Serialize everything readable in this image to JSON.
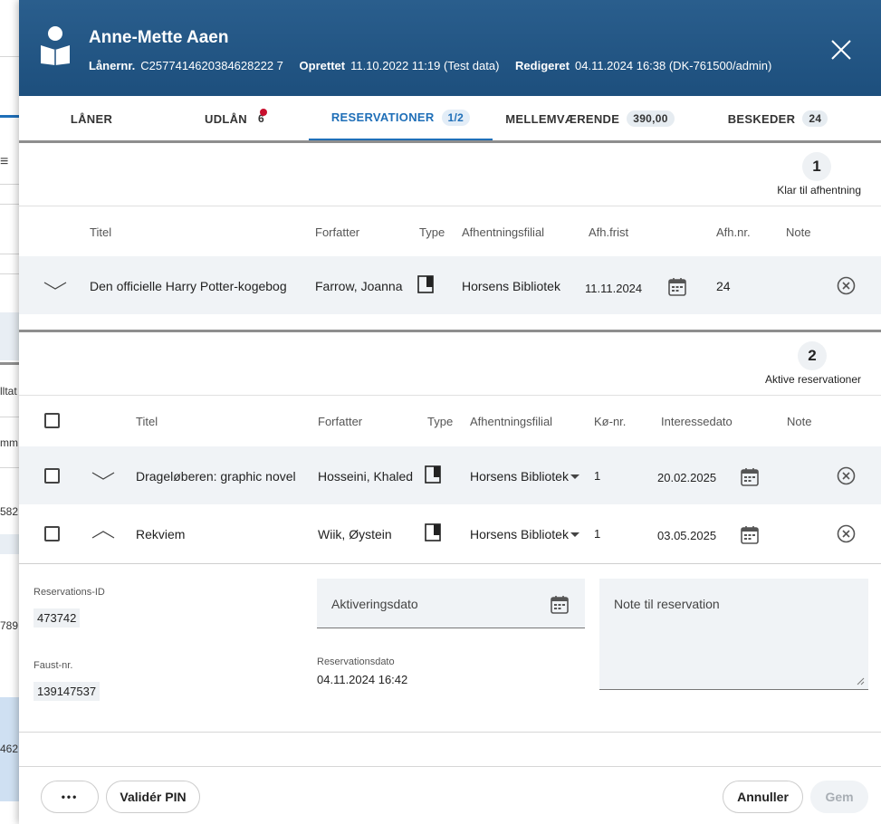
{
  "background": {
    "fragments": [
      "lltat",
      "mm",
      "582",
      "789",
      "462"
    ]
  },
  "header": {
    "name": "Anne-Mette Aaen",
    "laanernr_label": "Lånernr.",
    "laanernr_value": "C2577414620384628222 7",
    "oprettet_label": "Oprettet",
    "oprettet_value": "11.10.2022 11:19 (Test data)",
    "redigeret_label": "Redigeret",
    "redigeret_value": "04.11.2024 16:38 (DK-761500/admin)"
  },
  "tabs": [
    {
      "label": "LÅNER",
      "badge": ""
    },
    {
      "label": "UDLÅN",
      "badge": "6"
    },
    {
      "label": "RESERVATIONER",
      "badge": "1/2"
    },
    {
      "label": "MELLEMVÆRENDE",
      "badge": "390,00"
    },
    {
      "label": "BESKEDER",
      "badge": "24"
    }
  ],
  "section1": {
    "number": "1",
    "label": "Klar til afhentning",
    "columns": {
      "titel": "Titel",
      "forfatter": "Forfatter",
      "type": "Type",
      "afhentningsfilial": "Afhentningsfilial",
      "afhfrist": "Afh.frist",
      "afhnr": "Afh.nr.",
      "note": "Note"
    },
    "rows": [
      {
        "titel": "Den officielle Harry Potter-kogebog",
        "forfatter": "Farrow, Joanna",
        "filial": "Horsens Bibliotek",
        "frist": "11.11.2024",
        "afhnr": "24"
      }
    ]
  },
  "section2": {
    "number": "2",
    "label": "Aktive reservationer",
    "columns": {
      "titel": "Titel",
      "forfatter": "Forfatter",
      "type": "Type",
      "afhentningsfilial": "Afhentningsfilial",
      "koenr": "Kø-nr.",
      "interessedato": "Interessedato",
      "note": "Note"
    },
    "rows": [
      {
        "titel": "Drageløberen: graphic novel",
        "forfatter": "Hosseini, Khaled",
        "filial": "Horsens Bibliotek",
        "koenr": "1",
        "dato": "20.02.2025"
      },
      {
        "titel": "Rekviem",
        "forfatter": "Wiik, Øystein",
        "filial": "Horsens Bibliotek",
        "koenr": "1",
        "dato": "03.05.2025"
      }
    ]
  },
  "detail": {
    "reservations_id_label": "Reservations-ID",
    "reservations_id_value": "473742",
    "faust_label": "Faust-nr.",
    "faust_value": "139147537",
    "aktiveringsdato_placeholder": "Aktiveringsdato",
    "reservationsdato_label": "Reservationsdato",
    "reservationsdato_value": "04.11.2024 16:42",
    "note_placeholder": "Note til reservation"
  },
  "footer": {
    "more_label": "•••",
    "validate_pin_label": "Validér PIN",
    "cancel_label": "Annuller",
    "save_label": "Gem"
  }
}
